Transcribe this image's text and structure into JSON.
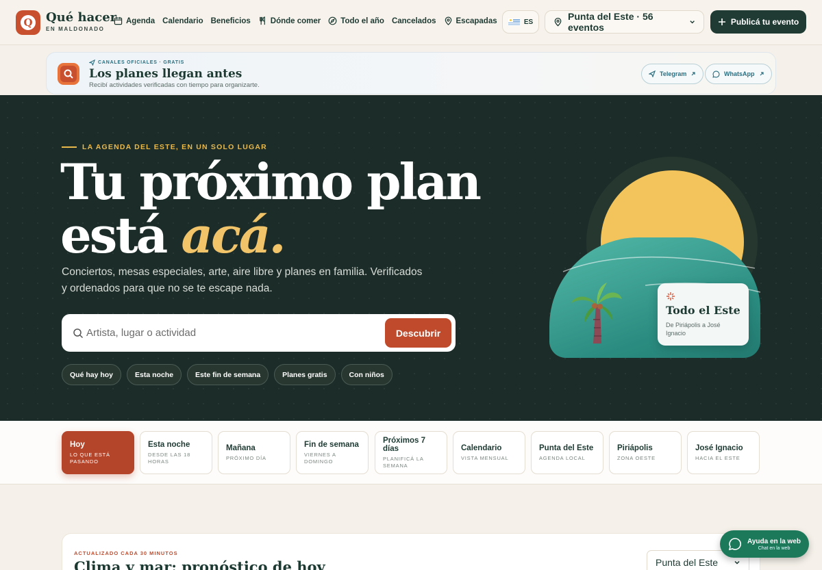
{
  "brand": {
    "name": "Qué hacer",
    "sub": "EN MALDONADO",
    "logo_letter": "Q"
  },
  "nav": [
    {
      "label": "Agenda",
      "icon": "calendar-icon"
    },
    {
      "label": "Calendario",
      "icon": ""
    },
    {
      "label": "Beneficios",
      "icon": ""
    },
    {
      "label": "Dónde comer",
      "icon": "fork-knife-icon"
    },
    {
      "label": "Todo el año",
      "icon": "compass-icon"
    },
    {
      "label": "Cancelados",
      "icon": ""
    },
    {
      "label": "Escapadas",
      "icon": "pin-icon"
    }
  ],
  "lang": {
    "code": "ES"
  },
  "location": {
    "label": "Punta del Este · 56 eventos"
  },
  "publish": {
    "label": "Publicá tu evento"
  },
  "channels": {
    "eyebrow": "CANALES OFICIALES · GRATIS",
    "title": "Los planes llegan antes",
    "subtitle": "Recibí actividades verificadas con tiempo para organizarte.",
    "telegram": "Telegram",
    "whatsapp": "WhatsApp"
  },
  "hero": {
    "eyebrow": "LA AGENDA DEL ESTE, EN UN SOLO LUGAR",
    "title_line1": "Tu próximo plan",
    "title_line2_a": "está ",
    "title_line2_b": "acá.",
    "lead": "Conciertos, mesas especiales, arte, aire libre y planes en familia. Verificados y ordenados para que no se te escape nada.",
    "search_placeholder": "Artista, lugar o actividad",
    "search_button": "Descubrir",
    "chips": [
      "Qué hay hoy",
      "Esta noche",
      "Este fin de semana",
      "Planes gratis",
      "Con niños"
    ]
  },
  "card": {
    "title": "Todo el Este",
    "subtitle": "De Piriápolis a José Ignacio"
  },
  "quick_tabs": [
    {
      "title": "Hoy",
      "sub": "LO QUE ESTÁ PASANDO",
      "active": true
    },
    {
      "title": "Esta noche",
      "sub": "DESDE LAS 18 HORAS"
    },
    {
      "title": "Mañana",
      "sub": "PRÓXIMO DÍA"
    },
    {
      "title": "Fin de semana",
      "sub": "VIERNES A DOMINGO"
    },
    {
      "title": "Próximos 7 días",
      "sub": "PLANIFICÁ LA SEMANA"
    },
    {
      "title": "Calendario",
      "sub": "VISTA MENSUAL"
    },
    {
      "title": "Punta del Este",
      "sub": "AGENDA LOCAL"
    },
    {
      "title": "Piriápolis",
      "sub": "ZONA OESTE"
    },
    {
      "title": "José Ignacio",
      "sub": "HACIA EL ESTE"
    }
  ],
  "weather": {
    "eyebrow": "ACTUALIZADO CADA 30 MINUTOS",
    "title": "Clima y mar: pronóstico de hoy",
    "select": "Punta del Este"
  },
  "help": {
    "title": "Ayuda en la web",
    "sub": "Chat en la web"
  },
  "colors": {
    "accent": "#bf4a2c",
    "dark": "#1c2c28",
    "sun": "#f3c45b",
    "teal": "#2a8c80",
    "brand": "#1d3a32"
  }
}
